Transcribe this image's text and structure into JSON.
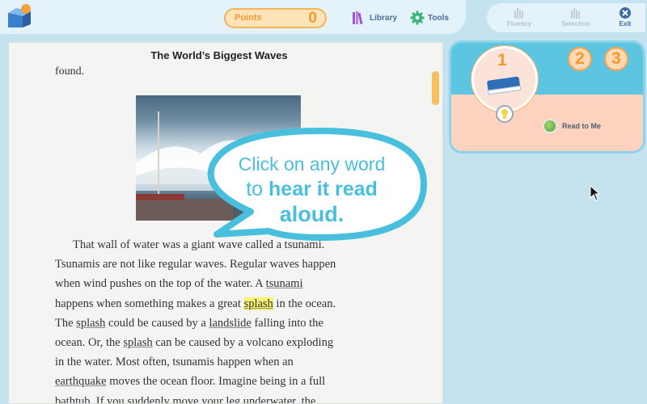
{
  "toolbar": {
    "points_label": "Points",
    "points_value": "0",
    "library_label": "Library",
    "tools_label": "Tools"
  },
  "view_controls": {
    "fluency_label": "Fluency",
    "selection_label": "Selection",
    "exit_label": "Exit"
  },
  "document": {
    "title": "The World’s Biggest Waves",
    "fragment_top": "found.",
    "callout": {
      "line1": "Click on any word",
      "line2_small": "to",
      "line2_bold": "hear it read",
      "line3": "aloud."
    },
    "paragraph": {
      "l1": "That wall of water was a giant wave called a tsunami.",
      "l2": "Tsunamis are not like regular waves. Regular waves happen",
      "l3": "when wind pushes on the top of the water. A",
      "l3_link": "tsunami",
      "l4a": "happens when something makes a great",
      "l4_highlight": "splash",
      "l4b": "in the ocean.",
      "l5a": "The",
      "l5_link1": "splash",
      "l5b": "could be caused by a",
      "l5_link2": "landslide",
      "l5c": "falling into the",
      "l6a": "ocean. Or, the",
      "l6_link": "splash",
      "l6b": "can be caused by a volcano exploding",
      "l7": "in the water. Most often, tsunamis happen when an",
      "l8_link": "earthquake",
      "l8b": "moves the ocean floor. Imagine being in a full",
      "l9": "bathtub. If you suddenly move your leg underwater, the"
    }
  },
  "reader_panel": {
    "step1": "1",
    "step2": "2",
    "step3": "3",
    "read_to_me_label": "Read to Me"
  },
  "colors": {
    "background": "#c4e3ee",
    "accent_orange": "#f39a2e",
    "callout_blue": "#48bfdc",
    "highlight": "#f7f26f"
  },
  "icons": {
    "logo": "book-stack-logo-icon",
    "library": "books-icon",
    "tools": "gear-icon",
    "fluency": "bar-chart-icon",
    "selection": "bar-chart-icon",
    "exit": "close-circle-icon",
    "book": "book-icon",
    "lightbulb": "lightbulb-icon",
    "read_to_me": "audio-orb-icon"
  }
}
